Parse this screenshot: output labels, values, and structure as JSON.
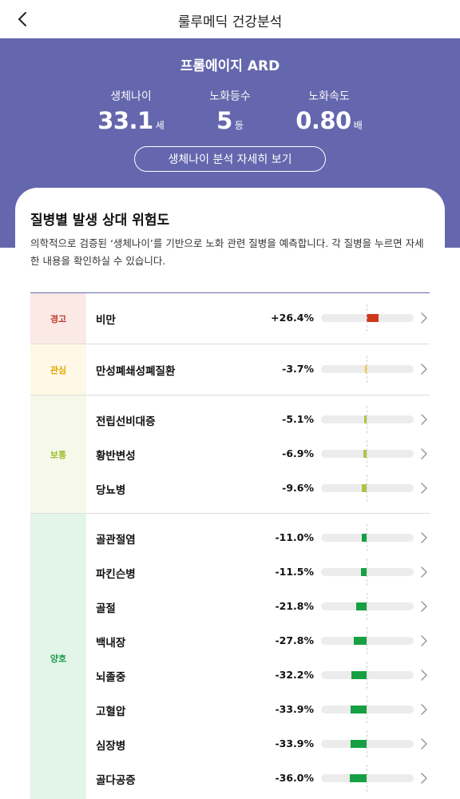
{
  "header": {
    "title": "룰루메딕 건강분석",
    "back_icon": "chevron-left-icon"
  },
  "hero": {
    "title": "프롬에이지 ARD",
    "bg_color": "#6467ad",
    "stats": [
      {
        "label": "생체나이",
        "value": "33.1",
        "unit": "세"
      },
      {
        "label": "노화등수",
        "value": "5",
        "unit": "등"
      },
      {
        "label": "노화속도",
        "value": "0.80",
        "unit": "배"
      }
    ],
    "detail_button": "생체나이 분석 자세히 보기"
  },
  "risk": {
    "title": "질병별 발생 상대 위험도",
    "description": "의학적으로 검증된 ‘생체나이’를 기반으로 노화 관련 질병을 예측합니다. 각 질병을 누르면 자세한 내용을 확인하실 수 있습니다.",
    "groups": [
      {
        "label": "경고",
        "text_color": "#c0392b",
        "bg_color": "#fbe9e5",
        "bar_color": "#d0381a",
        "items": [
          {
            "name": "비만",
            "percent": "+26.4%",
            "value": 26.4
          }
        ]
      },
      {
        "label": "관심",
        "text_color": "#e0a800",
        "bg_color": "#fff8e6",
        "bar_color": "#f3c63a",
        "items": [
          {
            "name": "만성폐쇄성폐질환",
            "percent": "-3.7%",
            "value": -3.7
          }
        ]
      },
      {
        "label": "보통",
        "text_color": "#9bbc2a",
        "bg_color": "#f6f8e9",
        "bar_color": "#a9c74a",
        "items": [
          {
            "name": "전립선비대증",
            "percent": "-5.1%",
            "value": -5.1
          },
          {
            "name": "황반변성",
            "percent": "-6.9%",
            "value": -6.9
          },
          {
            "name": "당뇨병",
            "percent": "-9.6%",
            "value": -9.6
          }
        ]
      },
      {
        "label": "양호",
        "text_color": "#1a9f4a",
        "bg_color": "#e3f5e8",
        "bar_color": "#17a043",
        "items": [
          {
            "name": "골관절염",
            "percent": "-11.0%",
            "value": -11.0
          },
          {
            "name": "파킨슨병",
            "percent": "-11.5%",
            "value": -11.5
          },
          {
            "name": "골절",
            "percent": "-21.8%",
            "value": -21.8
          },
          {
            "name": "백내장",
            "percent": "-27.8%",
            "value": -27.8
          },
          {
            "name": "뇌졸중",
            "percent": "-32.2%",
            "value": -32.2
          },
          {
            "name": "고혈압",
            "percent": "-33.9%",
            "value": -33.9
          },
          {
            "name": "심장병",
            "percent": "-33.9%",
            "value": -33.9
          },
          {
            "name": "골다공증",
            "percent": "-36.0%",
            "value": -36.0
          }
        ]
      }
    ]
  }
}
